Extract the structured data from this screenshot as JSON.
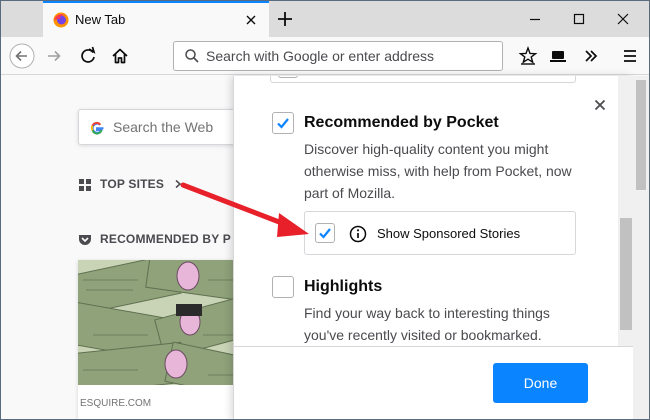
{
  "browser": {
    "tab": {
      "title": "New Tab"
    },
    "urlbar": {
      "placeholder": "Search with Google or enter address"
    }
  },
  "newtab": {
    "search_placeholder": "Search the Web",
    "top_sites_label": "TOP SITES",
    "recommended_label": "RECOMMENDED BY P",
    "card_source": "ESQUIRE.COM"
  },
  "preferences": {
    "pocket": {
      "checked": true,
      "title": "Recommended by Pocket",
      "description": [
        "Discover high-quality content you might",
        "otherwise miss, with help from Pocket, now",
        "part of Mozilla."
      ],
      "sponsored": {
        "checked": true,
        "label": "Show Sponsored Stories"
      }
    },
    "highlights": {
      "checked": false,
      "title": "Highlights",
      "description": [
        "Find your way back to interesting things",
        "you've recently visited or bookmarked."
      ]
    },
    "done_label": "Done"
  },
  "colors": {
    "accent": "#0a84ff",
    "annotation_arrow": "#e8202a"
  }
}
